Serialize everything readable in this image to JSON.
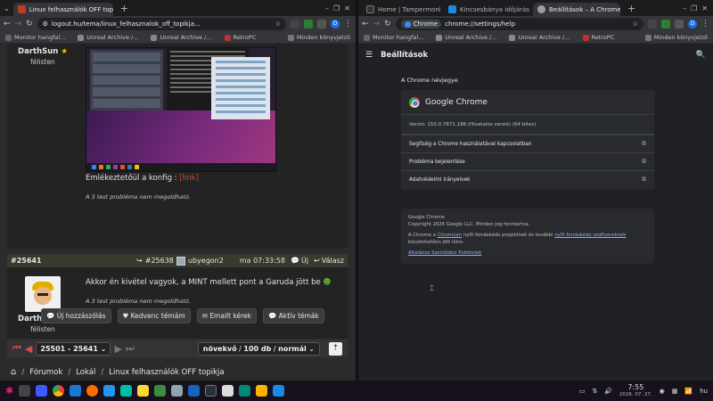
{
  "left": {
    "tab_title": "Linux felhasználók OFF topi",
    "url": "logout.hu/tema/linux_felhasznalok_off_topikja...",
    "bookmarks": [
      "Monitor hangfal...",
      "Unreal Archive /...",
      "Unreal Archive /...",
      "RetroPC"
    ],
    "bookmarks_other": "Minden könyvjelző",
    "post1": {
      "username": "DarthSun",
      "status": "félisten",
      "text": "Emlékeztetőül a konfig : ",
      "link": "[link]",
      "signature": "A 3 test probléma nem megoldható."
    },
    "post2": {
      "id": "#25641",
      "reply_to": "#25638",
      "reply_user": "ubyegon2",
      "time": "ma 07:33:58",
      "new_label": "Új",
      "answer_label": "Válasz",
      "username": "DarthSun",
      "status": "félisten",
      "text": "Akkor én kivétel vagyok, a MINT mellett pont a Garuda jött be ",
      "signature": "A 3 test probléma nem megoldható."
    },
    "actions": [
      "Új hozzászólás",
      "Kedvenc témám",
      "Emailt kérek",
      "Aktív témák"
    ],
    "pager": {
      "range": "25501 - 25641",
      "sort_dir": "növekvő",
      "per_page": "100 db",
      "mode": "normál"
    },
    "breadcrumbs": [
      "Fórumok",
      "Lokál",
      "Linux felhasználók OFF topikja"
    ]
  },
  "right": {
    "tabs": [
      "Home | Tampermonkey",
      "Kincsesbánya időjárás - Id",
      "Beállítások – A Chrome né"
    ],
    "omni_chip": "Chrome",
    "url": "chrome://settings/help",
    "bookmarks": [
      "Monitor hangfal...",
      "Unreal Archive /...",
      "Unreal Archive /...",
      "RetroPC"
    ],
    "bookmarks_other": "Minden könyvjelző",
    "page_title": "Beállítások",
    "section_title": "A Chrome névjegye",
    "product": "Google Chrome",
    "version": "Verzió: 150.0.7871.186 (Hivatalos verzió) (64 bites)",
    "links": [
      "Segítség a Chrome használatával kapcsolatban",
      "Probléma bejelentése",
      "Adatvédelmi irányelvek"
    ],
    "about": {
      "name": "Google Chrome",
      "copyright": "Copyright 2026 Google LLC. Minden jog fenntartva.",
      "line1a": "A Chrome a ",
      "chromium": "Chromium",
      "line1b": " nyílt forráskódú projektnek és további ",
      "oss": "nyílt forráskódú szoftvereknek",
      "line1c": " köszönhetően jött létre.",
      "tos": "Általános Szerződési Feltételek"
    }
  },
  "taskbar": {
    "time": "7:55",
    "date": "2026. 07. 27.",
    "lang": "hu"
  }
}
